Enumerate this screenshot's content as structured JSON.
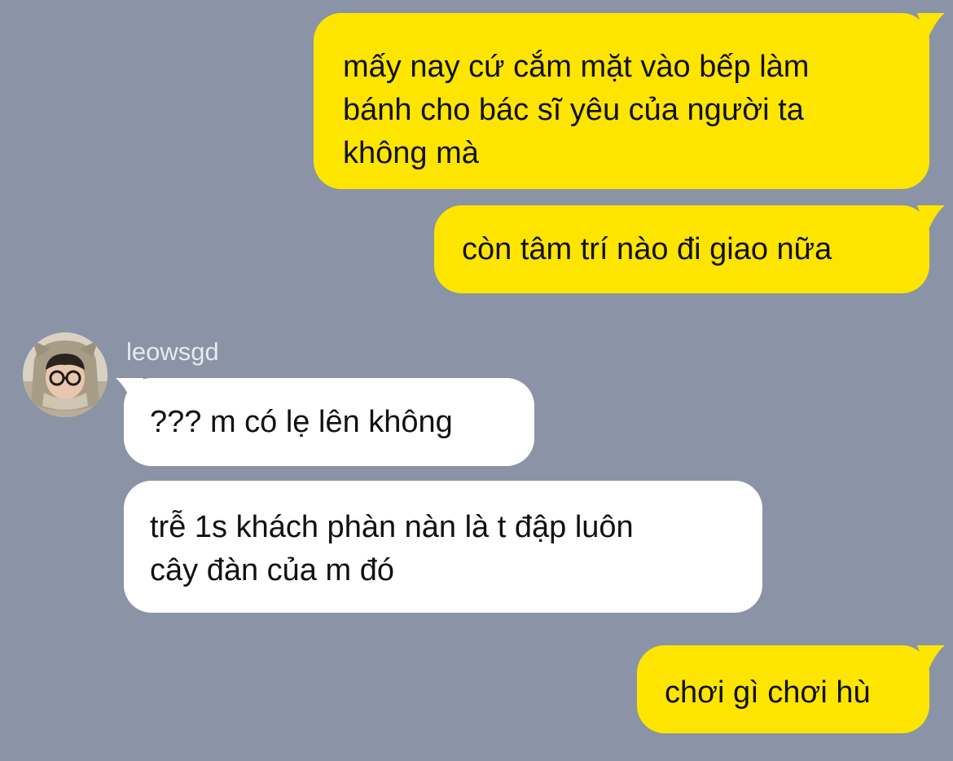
{
  "chat": {
    "background_color": "#8a94a6",
    "my_bubble_color": "#fee500",
    "their_bubble_color": "#ffffff",
    "messages": [
      {
        "sender": "me",
        "text": "mấy nay cứ cắm mặt vào bếp làm\nbánh cho bác sĩ yêu của người ta\nkhông mà"
      },
      {
        "sender": "me",
        "text": "còn tâm trí nào đi giao nữa"
      },
      {
        "sender": "them",
        "text": "??? m có lẹ lên không"
      },
      {
        "sender": "them",
        "text": "trễ 1s khách phàn nàn là t đập luôn\ncây đàn của m đó"
      },
      {
        "sender": "me",
        "text": "chơi gì chơi hù"
      }
    ],
    "contact": {
      "name": "leowsgd",
      "avatar_icon": "user-avatar-photo"
    }
  }
}
